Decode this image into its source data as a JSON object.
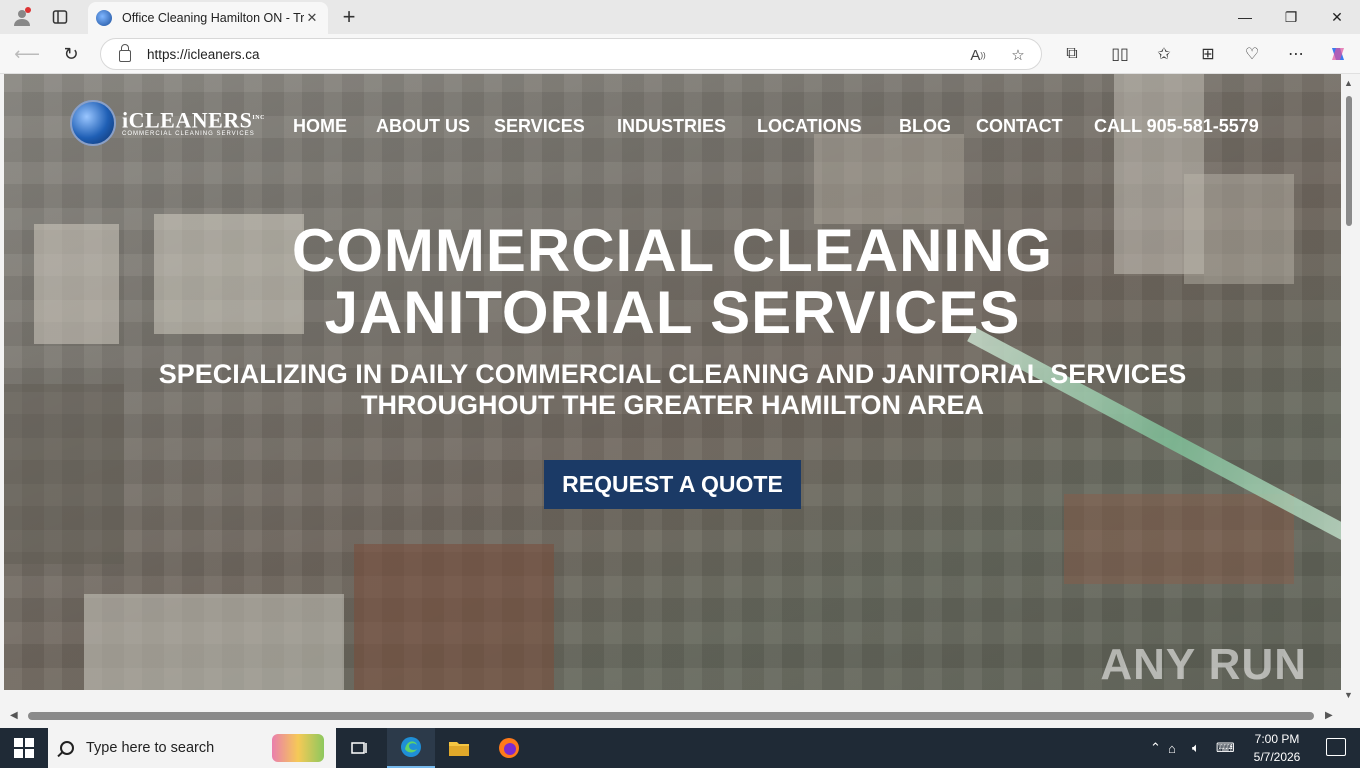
{
  "browser": {
    "tab_title": "Office Cleaning Hamilton ON - Tr",
    "url": "https://icleaners.ca",
    "icons": {
      "profile": "profile-icon",
      "tab_actions": "tab-actions-icon",
      "tab_close": "close-icon",
      "new_tab": "plus-icon",
      "minimize": "minimize-icon",
      "restore": "restore-icon",
      "close_window": "close-icon",
      "back": "back-arrow-icon",
      "refresh": "refresh-icon",
      "lock": "lock-icon",
      "read_aloud": "read-aloud-icon",
      "favorite": "star-icon",
      "extensions": "puzzle-icon",
      "split": "split-screen-icon",
      "favorites": "favorites-icon",
      "collections": "collections-icon",
      "performance": "heart-pulse-icon",
      "more": "more-icon",
      "copilot": "copilot-icon"
    },
    "window_controls": {
      "minimize": "—",
      "restore": "❐",
      "close": "✕"
    }
  },
  "site": {
    "logo_name": "iCLEANERS",
    "logo_mark": "INC",
    "logo_sub": "COMMERCIAL CLEANING SERVICES",
    "nav": [
      "HOME",
      "ABOUT US",
      "SERVICES",
      "INDUSTRIES",
      "LOCATIONS",
      "BLOG",
      "CONTACT",
      "CALL 905-581-5579"
    ],
    "headline_line1": "COMMERCIAL CLEANING",
    "headline_line2": "JANITORIAL SERVICES",
    "subhead_line1": "SPECIALIZING IN DAILY COMMERCIAL CLEANING AND JANITORIAL SERVICES",
    "subhead_line2": "THROUGHOUT THE GREATER HAMILTON AREA",
    "cta": "REQUEST A QUOTE",
    "cta_color": "#1b3a66"
  },
  "watermark": "ANY RUN",
  "taskbar": {
    "search_placeholder": "Type here to search",
    "time": "7:00 PM",
    "date": "5/7/2026",
    "apps": [
      "task-view-icon",
      "edge-icon",
      "file-explorer-icon",
      "firefox-icon"
    ]
  }
}
